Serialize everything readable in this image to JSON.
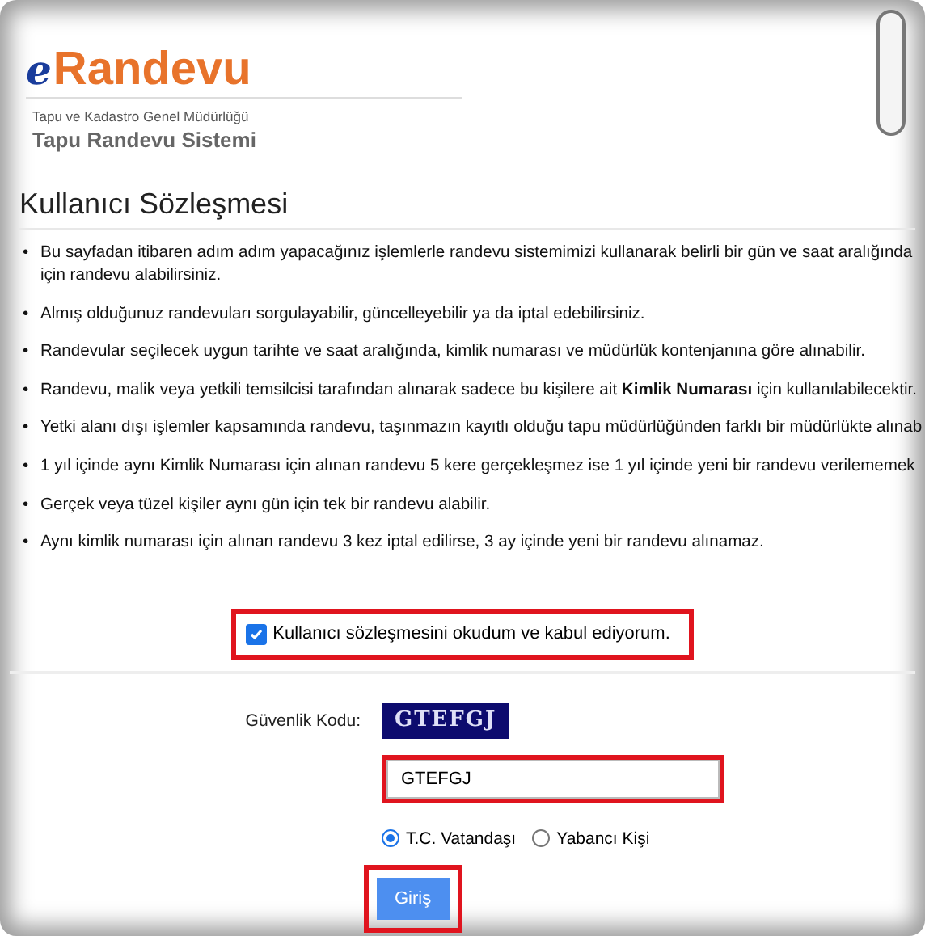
{
  "header": {
    "logo_prefix": "e",
    "logo": "Randevu",
    "organization": "Tapu ve Kadastro Genel Müdürlüğü",
    "system": "Tapu Randevu Sistemi"
  },
  "heading": "Kullanıcı Sözleşmesi",
  "bullet": "•",
  "terms": [
    {
      "lines": [
        "Bu sayfadan itibaren adım adım yapacağınız işlemlerle randevu sistemimizi kullanarak belirli bir gün ve saat aralığında",
        "için randevu alabilirsiniz."
      ]
    },
    {
      "lines": [
        "Almış olduğunuz randevuları sorgulayabilir, güncelleyebilir ya da iptal edebilirsiniz."
      ]
    },
    {
      "lines": [
        "Randevular seçilecek uygun tarihte ve saat aralığında, kimlik numarası ve müdürlük kontenjanına göre alınabilir."
      ]
    },
    {
      "lines": [
        "Randevu, malik veya yetkili temsilcisi tarafından alınarak sadece bu kişilere ait **Kimlik Numarası** için kullanılabilecektir."
      ]
    },
    {
      "lines": [
        "Yetki alanı dışı işlemler kapsamında randevu, taşınmazın kayıtlı olduğu tapu müdürlüğünden farklı bir müdürlükte alınab"
      ]
    },
    {
      "lines": [
        "1 yıl içinde aynı Kimlik Numarası için alınan randevu 5 kere gerçekleşmez ise 1 yıl içinde yeni bir randevu verilememek"
      ]
    },
    {
      "lines": [
        "Gerçek veya tüzel kişiler aynı gün için tek bir randevu alabilir."
      ]
    },
    {
      "lines": [
        "Aynı kimlik numarası için alınan randevu 3 kez iptal edilirse, 3 ay içinde yeni bir randevu alınamaz."
      ]
    }
  ],
  "agreement": {
    "label": "Kullanıcı sözleşmesini okudum ve kabul ediyorum.",
    "checked": true,
    "highlighted": true
  },
  "security": {
    "label": "Güvenlik Kodu:",
    "captcha": "GTEFGJ",
    "value": "GTEFGJ",
    "highlighted": true
  },
  "citizenship": [
    {
      "label": "T.C. Vatandaşı",
      "selected": true
    },
    {
      "label": "Yabancı Kişi",
      "selected": false
    }
  ],
  "submit": {
    "label": "Giriş",
    "highlighted": true
  }
}
